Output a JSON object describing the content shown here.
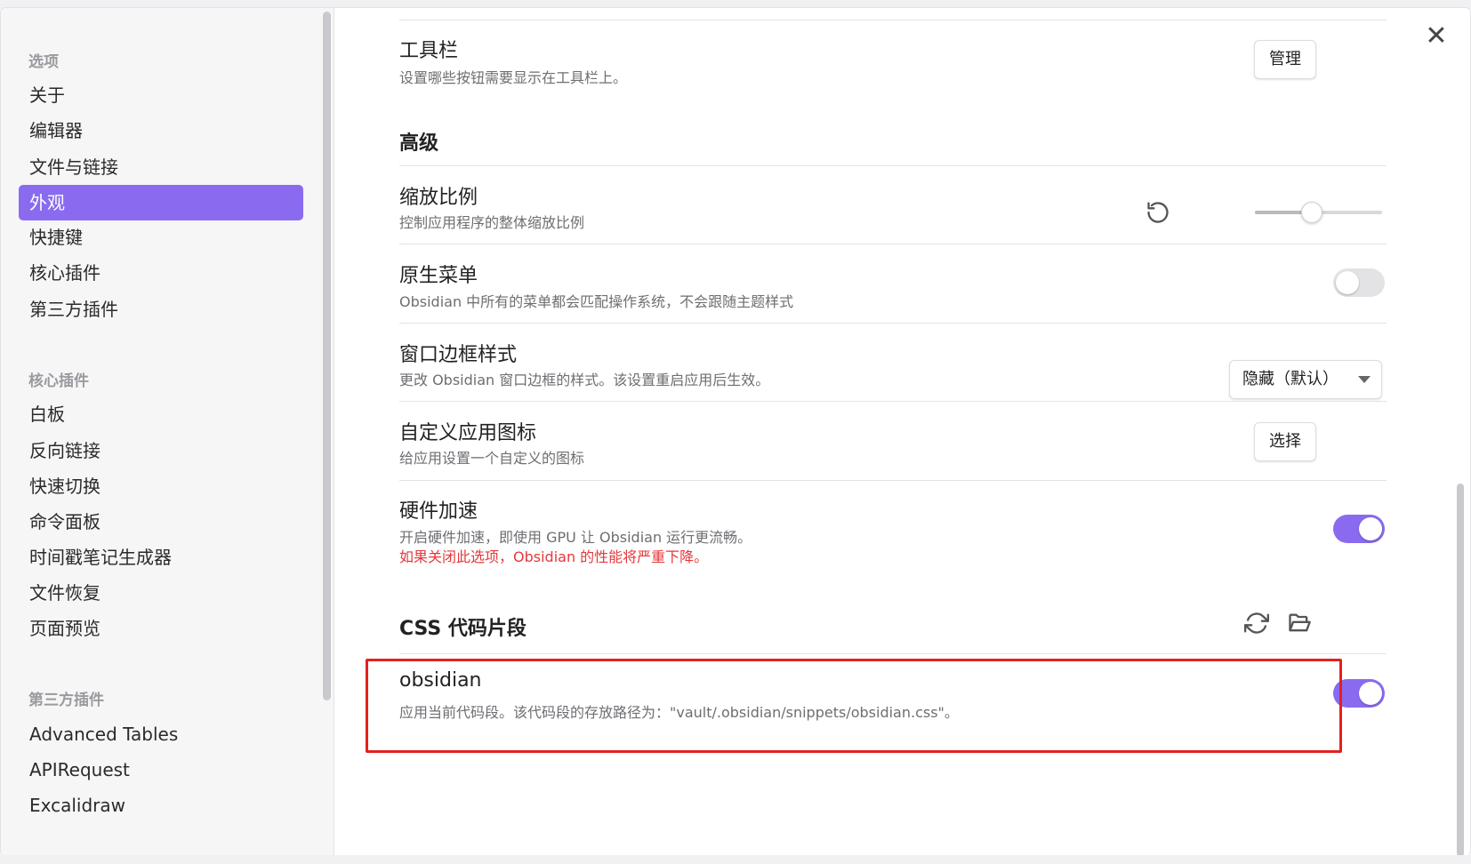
{
  "sidebar": {
    "groups": [
      {
        "title": "选项",
        "items": [
          "关于",
          "编辑器",
          "文件与链接",
          "外观",
          "快捷键",
          "核心插件",
          "第三方插件"
        ]
      },
      {
        "title": "核心插件",
        "items": [
          "白板",
          "反向链接",
          "快速切换",
          "命令面板",
          "时间戳笔记生成器",
          "文件恢复",
          "页面预览"
        ]
      },
      {
        "title": "第三方插件",
        "items": [
          "Advanced Tables",
          "APIRequest",
          "Excalidraw"
        ]
      }
    ],
    "active_item": "外观"
  },
  "settings": {
    "toolbar": {
      "name": "工具栏",
      "desc": "设置哪些按钮需要显示在工具栏上。",
      "button": "管理"
    },
    "advanced_heading": "高级",
    "zoom": {
      "name": "缩放比例",
      "desc": "控制应用程序的整体缩放比例",
      "level": 0.45
    },
    "native_menu": {
      "name": "原生菜单",
      "desc": "Obsidian 中所有的菜单都会匹配操作系统，不会跟随主题样式",
      "enabled": false
    },
    "frame_style": {
      "name": "窗口边框样式",
      "desc": "更改 Obsidian 窗口边框的样式。该设置重启应用后生效。",
      "selected": "隐藏（默认）"
    },
    "custom_icon": {
      "name": "自定义应用图标",
      "desc": "给应用设置一个自定义的图标",
      "button": "选择"
    },
    "hw_accel": {
      "name": "硬件加速",
      "desc": "开启硬件加速，即使用 GPU 让 Obsidian 运行更流畅。",
      "warning": "如果关闭此选项，Obsidian 的性能将严重下降。",
      "enabled": true
    },
    "css_heading": "CSS 代码片段",
    "snippet": {
      "name": "obsidian",
      "desc": "应用当前代码段。该代码段的存放路径为：\"vault/.obsidian/snippets/obsidian.css\"。",
      "enabled": true
    }
  },
  "colors": {
    "accent": "#8a6bf0",
    "warning": "#e5383b",
    "highlight": "#e4201e"
  },
  "icons": {
    "close": "close-icon",
    "reset": "reset-icon",
    "reload": "reload-icon",
    "folder": "folder-open-icon"
  }
}
